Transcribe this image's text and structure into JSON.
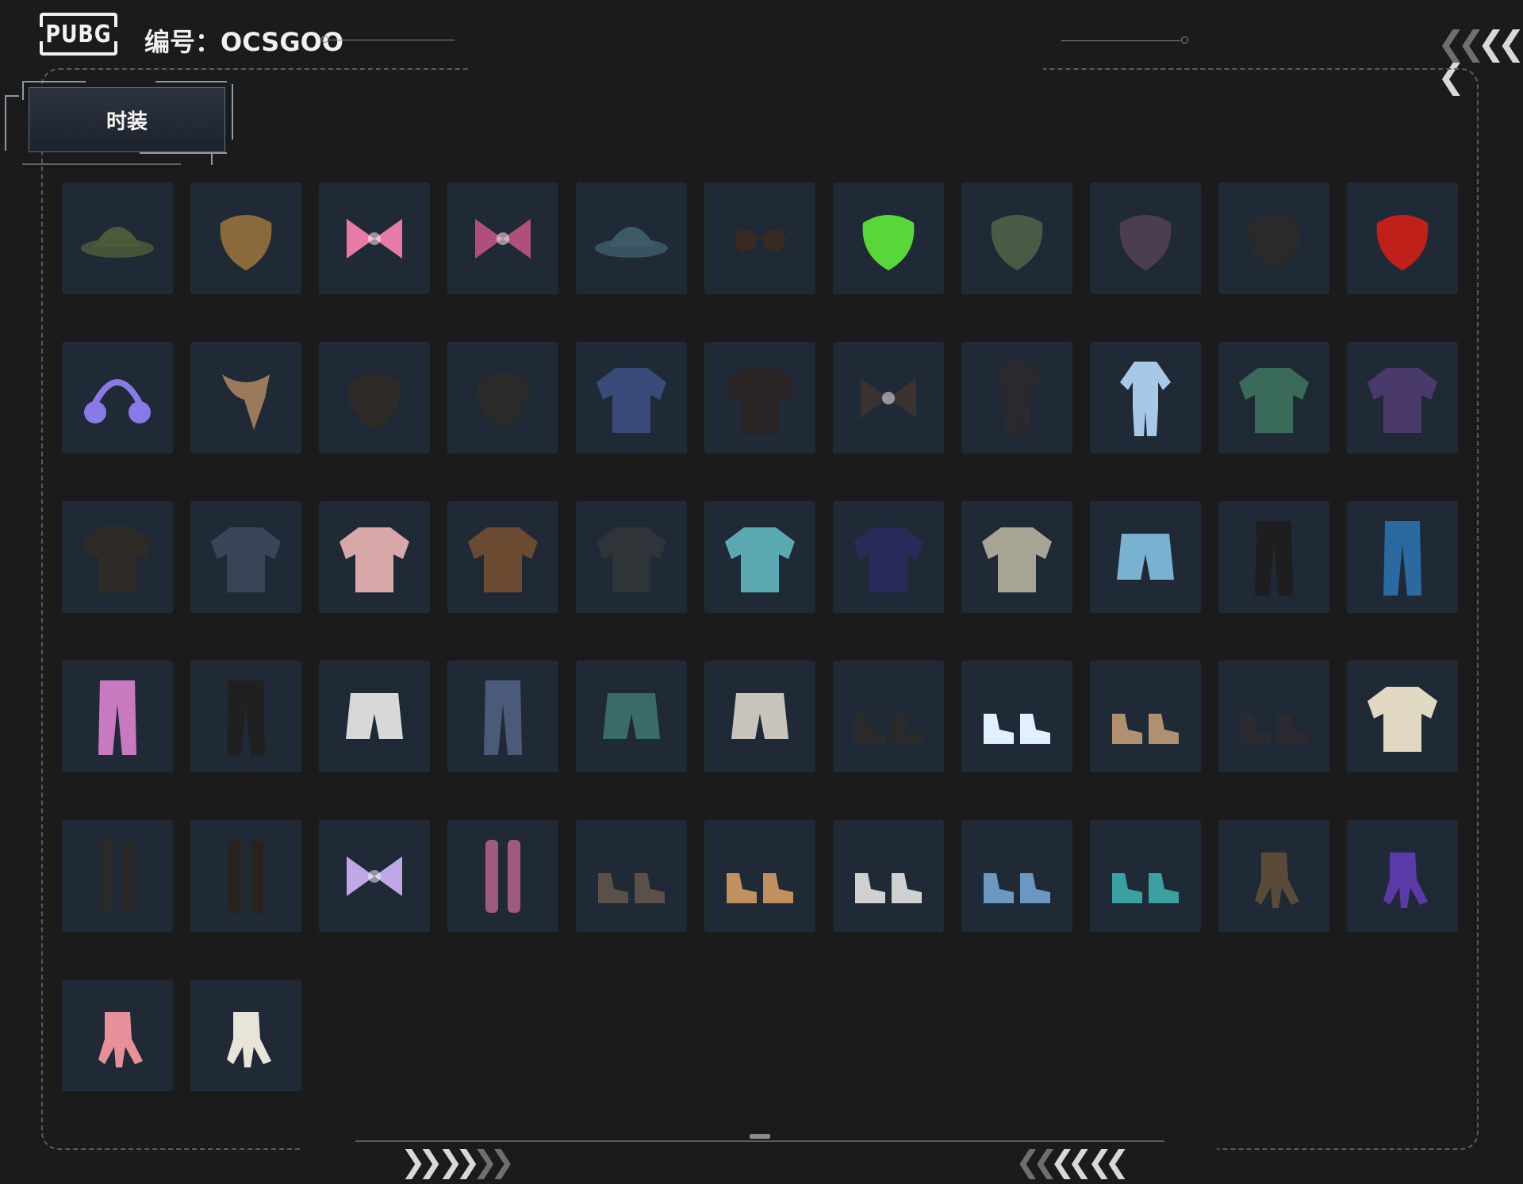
{
  "header": {
    "logo_text": "PUBG",
    "serial": "编号：OCSGOO"
  },
  "category_tab": {
    "label": "时装"
  },
  "items": [
    {
      "name": "headset-cap-icon",
      "color": "#4e5a3a"
    },
    {
      "name": "plague-mask-icon",
      "color": "#8a6a3a"
    },
    {
      "name": "pink-bow-headband-icon",
      "color": "#e87aa8"
    },
    {
      "name": "bunny-ear-hood-icon",
      "color": "#b0507a"
    },
    {
      "name": "bucket-hat-icon",
      "color": "#3e5a66"
    },
    {
      "name": "round-sunglasses-icon",
      "color": "#3a2a22"
    },
    {
      "name": "frog-mask-icon",
      "color": "#59d63a"
    },
    {
      "name": "camo-face-wrap-icon",
      "color": "#4a5a44"
    },
    {
      "name": "purple-bandana-icon",
      "color": "#4a3e50"
    },
    {
      "name": "black-skull-mask-icon",
      "color": "#2a2a2a"
    },
    {
      "name": "red-oni-mask-icon",
      "color": "#c0201a"
    },
    {
      "name": "cute-headphones-icon",
      "color": "#8a7ae8"
    },
    {
      "name": "patterned-scarf-icon",
      "color": "#9a7a5a"
    },
    {
      "name": "black-face-mask-icon",
      "color": "#2e2a28"
    },
    {
      "name": "star-bandana-icon",
      "color": "#2a2a2a"
    },
    {
      "name": "ace-tank-top-icon",
      "color": "#3a4a7a"
    },
    {
      "name": "tactical-vest-icon",
      "color": "#2a2424"
    },
    {
      "name": "heart-crop-top-icon",
      "color": "#3a3230"
    },
    {
      "name": "black-bodysuit-icon",
      "color": "#2a2a2e"
    },
    {
      "name": "shark-onesie-icon",
      "color": "#a8c8e8"
    },
    {
      "name": "floral-shirt-icon",
      "color": "#3a6a5a"
    },
    {
      "name": "purple-jacket-icon",
      "color": "#4a3a6a"
    },
    {
      "name": "leather-jacket-icon",
      "color": "#2e2a26"
    },
    {
      "name": "denim-jacket-icon",
      "color": "#3a4658"
    },
    {
      "name": "pink-jacket-icon",
      "color": "#d8a8a8"
    },
    {
      "name": "fur-hooded-coat-icon",
      "color": "#6a4a30"
    },
    {
      "name": "racing-jacket-icon",
      "color": "#2e3438"
    },
    {
      "name": "duck-hoodie-icon",
      "color": "#5aa8b0"
    },
    {
      "name": "navy-sweatshirt-icon",
      "color": "#2a2a5a"
    },
    {
      "name": "cargo-sweatpants-icon",
      "color": "#a8a494"
    },
    {
      "name": "denim-shorts-icon",
      "color": "#7ab0d0"
    },
    {
      "name": "black-hot-pants-icon",
      "color": "#1e1e1e"
    },
    {
      "name": "patched-jeans-icon",
      "color": "#2a6aa0"
    },
    {
      "name": "pink-anime-pants-icon",
      "color": "#c87ac0"
    },
    {
      "name": "black-leggings-icon",
      "color": "#202020"
    },
    {
      "name": "ripped-white-shorts-icon",
      "color": "#d8d8d8"
    },
    {
      "name": "flared-jeans-icon",
      "color": "#4a5a78"
    },
    {
      "name": "teal-shorts-leggings-icon",
      "color": "#3a6a6a"
    },
    {
      "name": "khaki-shorts-icon",
      "color": "#c8c4bc"
    },
    {
      "name": "loafers-with-socks-icon",
      "color": "#2a2a2a"
    },
    {
      "name": "fluffy-white-boots-icon",
      "color": "#e0f0ff"
    },
    {
      "name": "tan-combat-boots-icon",
      "color": "#b09070"
    },
    {
      "name": "black-platform-boots-icon",
      "color": "#2a2a30"
    },
    {
      "name": "white-hightop-sneakers-icon",
      "color": "#e0d8c0"
    },
    {
      "name": "ripped-stockings-boots-icon",
      "color": "#2a2a2a"
    },
    {
      "name": "black-stockings-icon",
      "color": "#2a221e"
    },
    {
      "name": "rainbow-leg-warmers-icon",
      "color": "#c0a8e8"
    },
    {
      "name": "pink-boots-stockings-icon",
      "color": "#a05a80"
    },
    {
      "name": "bunny-sneakers-icon",
      "color": "#5a5048"
    },
    {
      "name": "canvas-sneakers-icon",
      "color": "#c09060"
    },
    {
      "name": "white-sock-shoes-icon",
      "color": "#d0d0d0"
    },
    {
      "name": "shark-slippers-icon",
      "color": "#6a98c0"
    },
    {
      "name": "teal-clogs-icon",
      "color": "#3aa0a0"
    },
    {
      "name": "jeweled-gloves-icon",
      "color": "#5a4a38"
    },
    {
      "name": "purple-claw-gloves-icon",
      "color": "#5a3aa8"
    },
    {
      "name": "pink-knit-glove-icon",
      "color": "#e8909a"
    },
    {
      "name": "white-cuff-glove-icon",
      "color": "#e8e4da"
    }
  ]
}
